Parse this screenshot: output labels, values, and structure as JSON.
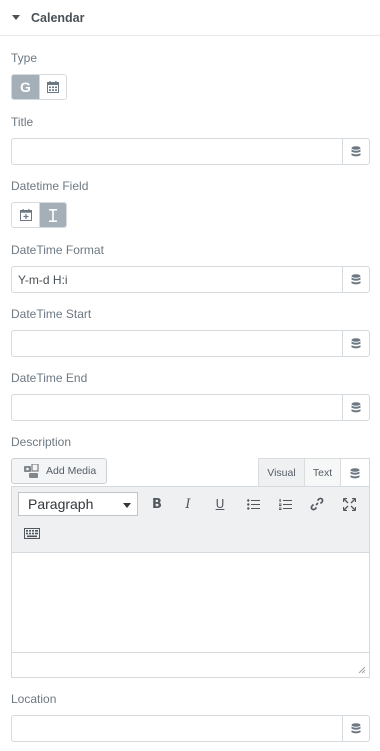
{
  "section": {
    "title": "Calendar"
  },
  "type": {
    "label": "Type",
    "options": [
      {
        "icon": "google-icon",
        "glyph": "G",
        "active": true
      },
      {
        "icon": "calendar-grid-icon",
        "active": false
      }
    ]
  },
  "title_field": {
    "label": "Title",
    "value": ""
  },
  "datetime_field": {
    "label": "Datetime Field",
    "options": [
      {
        "icon": "calendar-plus-icon",
        "active": false
      },
      {
        "icon": "text-cursor-icon",
        "active": true
      }
    ]
  },
  "datetime_format": {
    "label": "DateTime Format",
    "value": "Y-m-d H:i"
  },
  "datetime_start": {
    "label": "DateTime Start",
    "value": ""
  },
  "datetime_end": {
    "label": "DateTime End",
    "value": ""
  },
  "description": {
    "label": "Description",
    "add_media_label": "Add Media",
    "tabs": {
      "visual": "Visual",
      "text": "Text"
    },
    "format_selected": "Paragraph",
    "toolbar_icons": [
      "bold-icon",
      "italic-icon",
      "underline-icon",
      "bullet-list-icon",
      "numbered-list-icon",
      "link-icon",
      "fullscreen-icon",
      "keyboard-icon"
    ],
    "glyphs": {
      "bold": "B",
      "italic": "I",
      "underline": "U"
    }
  },
  "location": {
    "label": "Location",
    "value": ""
  },
  "colors": {
    "active_toggle": "#a4afb7",
    "border": "#d5dadf",
    "label": "#6d7882",
    "heading": "#495157"
  }
}
